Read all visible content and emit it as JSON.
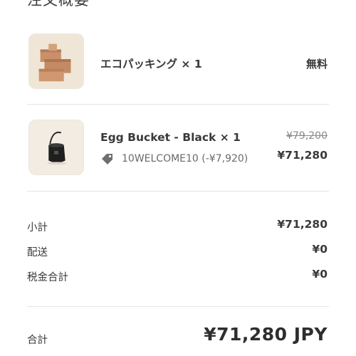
{
  "summary": {
    "title": "注文概要",
    "items": [
      {
        "name": "エコパッキング × 1",
        "image_icon": "cardboard-boxes",
        "price": "無料"
      },
      {
        "name": "Egg Bucket - Black × 1",
        "image_icon": "black-bucket-bag",
        "original_price": "¥79,200",
        "price": "¥71,280",
        "discount_icon": "tag-icon",
        "discount_code": "10WELCOME10 (-¥7,920)"
      }
    ],
    "subtotal_label": "小計",
    "subtotal_value": "¥71,280",
    "shipping_label": "配送",
    "shipping_value": "¥0",
    "tax_label": "税金合計",
    "tax_value": "¥0",
    "total_label": "合計",
    "total_value": "¥71,280 JPY"
  },
  "colors": {
    "text": "#3a3a3a",
    "muted": "#8a8a8a",
    "divider": "#e4e4e4",
    "thumb_bg": "#f3ece2"
  }
}
